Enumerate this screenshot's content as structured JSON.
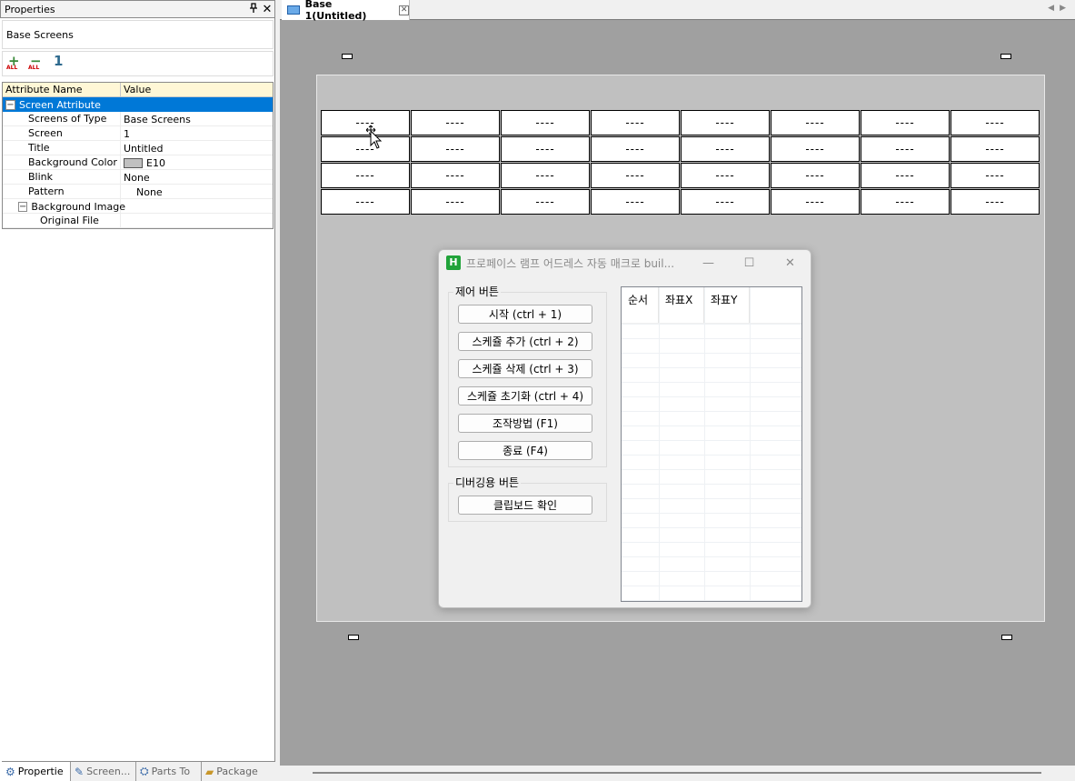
{
  "properties_panel": {
    "title": "Properties",
    "pin_icon": "pin-icon",
    "close_label": "✕",
    "selected_object": "Base Screens",
    "toolbar": {
      "add_all": "ALL",
      "remove_all": "ALL",
      "sort": "1"
    },
    "columns": {
      "name": "Attribute Name",
      "value": "Value"
    },
    "group": "Screen Attribute",
    "rows": [
      {
        "name": "Screens of Type",
        "value": "Base Screens"
      },
      {
        "name": "Screen",
        "value": "1"
      },
      {
        "name": "Title",
        "value": "Untitled"
      },
      {
        "name": "Background Color",
        "value": "E10"
      },
      {
        "name": "Blink",
        "value": "None"
      },
      {
        "name": "Pattern",
        "value": "None"
      }
    ],
    "subgroup": "Background Image",
    "subrow": {
      "name": "Original File",
      "value": ""
    },
    "bottom_tabs": [
      "Propertie",
      "Screen...",
      "Parts To",
      "Package"
    ]
  },
  "document": {
    "tab_label": "Base 1(Untitled)",
    "lamp_text": "----",
    "lamps_rows": 4,
    "lamps_cols": 8
  },
  "app_window": {
    "logo": "H",
    "title": "프로페이스 램프 어드레스 자동 매크로 buil...",
    "controls": {
      "minimize": "—",
      "maximize": "☐",
      "close": "✕"
    },
    "control_group": "제어 버튼",
    "buttons": [
      "시작 (ctrl + 1)",
      "스케쥴 추가 (ctrl + 2)",
      "스케쥴 삭제 (ctrl + 3)",
      "스케쥴 초기화 (ctrl + 4)",
      "조작방법 (F1)",
      "종료 (F4)"
    ],
    "debug_group": "디버깅용 버튼",
    "debug_button": "클립보드 확인",
    "list_columns": [
      "순서",
      "좌표X",
      "좌표Y"
    ]
  }
}
